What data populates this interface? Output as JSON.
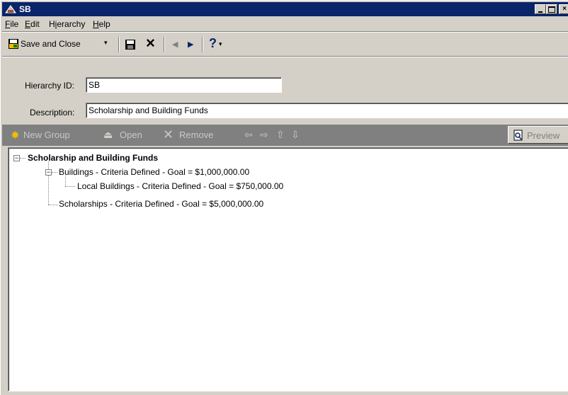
{
  "window": {
    "title": "SB",
    "minimize": "_",
    "maximize": "□",
    "close": "×"
  },
  "menu": [
    {
      "label": "File",
      "accel": "F",
      "rest": "ile"
    },
    {
      "label": "Edit",
      "accel": "E",
      "rest": "dit"
    },
    {
      "label": "Hierarchy",
      "pre": "H",
      "accel": "i",
      "rest": "erarchy"
    },
    {
      "label": "Help",
      "accel": "H",
      "rest": "elp"
    }
  ],
  "toolbar": {
    "save_close_label": "Save and Close",
    "icons": [
      "save-icon",
      "delete-icon",
      "previous-icon",
      "next-icon",
      "help-icon"
    ]
  },
  "form": {
    "hierarchy_id_label": "Hierarchy ID:",
    "hierarchy_id_value": "SB",
    "description_label": "Description:",
    "description_value": "Scholarship and Building Funds"
  },
  "group_toolbar": {
    "new_group": "New Group",
    "open": "Open",
    "remove": "Remove",
    "preview": "Preview"
  },
  "tree": {
    "root": "Scholarship and Building Funds",
    "buildings": "Buildings  -  Criteria Defined  -  Goal = $1,000,000.00",
    "local_buildings": "Local Buildings  -  Criteria Defined  -  Goal = $750,000.00",
    "scholarships": "Scholarships  -  Criteria Defined  -  Goal = $5,000,000.00"
  },
  "colors": {
    "titlebar": "#0a246a",
    "face": "#d4d0c8",
    "group_toolbar": "#808080",
    "accent_yellow": "#f0c000"
  }
}
